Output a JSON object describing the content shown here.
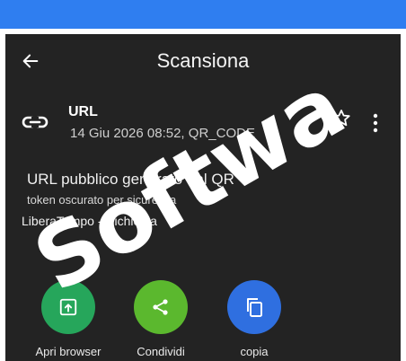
{
  "toolbar": {
    "title": "Scansiona",
    "back_icon": "arrow-left-icon"
  },
  "result": {
    "type": "URL",
    "meta": "14 Giu 2026 08:52, QR_CODE",
    "icons": {
      "type": "link-icon",
      "favorite": "star-outline-icon",
      "more": "more-vertical-icon"
    }
  },
  "content": {
    "title": "URL pubblico generato dal QR",
    "subtitle": "token oscurato per sicurezza",
    "extra": "LiberaTempo - Richiesta"
  },
  "actions": [
    {
      "label": "Apri browser",
      "icon": "open-in-browser-icon",
      "color": "#26a65b"
    },
    {
      "label": "Condividi",
      "icon": "share-icon",
      "color": "#5bb82e"
    },
    {
      "label": "copia",
      "icon": "copy-icon",
      "color": "#2f6fe0"
    }
  ],
  "watermark": "Softwa",
  "colors": {
    "status_bar": "#2f7ef0",
    "background": "#232323"
  }
}
